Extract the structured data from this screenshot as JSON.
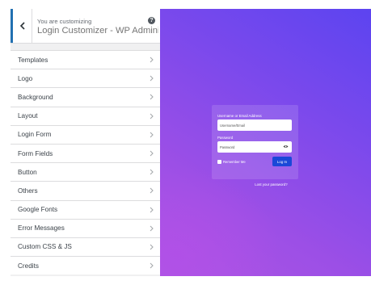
{
  "header": {
    "customizing_label": "You are customizing",
    "title": "Login Customizer - WP Adminify",
    "help_glyph": "?"
  },
  "sidebar": {
    "items": [
      {
        "label": "Templates",
        "name": "templates"
      },
      {
        "label": "Logo",
        "name": "logo"
      },
      {
        "label": "Background",
        "name": "background"
      },
      {
        "label": "Layout",
        "name": "layout"
      },
      {
        "label": "Login Form",
        "name": "login-form"
      },
      {
        "label": "Form Fields",
        "name": "form-fields"
      },
      {
        "label": "Button",
        "name": "button"
      },
      {
        "label": "Others",
        "name": "others"
      },
      {
        "label": "Google Fonts",
        "name": "google-fonts"
      },
      {
        "label": "Error Messages",
        "name": "error-messages"
      },
      {
        "label": "Custom CSS & JS",
        "name": "custom-css-js"
      },
      {
        "label": "Credits",
        "name": "credits"
      }
    ]
  },
  "preview": {
    "username_label": "Username or Email Address",
    "username_value": "Username/Email",
    "password_label": "Password",
    "password_value": "Password",
    "remember_label": "Remember Me",
    "login_button": "Log In",
    "lost_password": "Lost your password?"
  },
  "colors": {
    "accent": "#2271b1",
    "button": "#1a48d8",
    "bg_start": "#5c44f0",
    "bg_end": "#ad55e2"
  },
  "icons": {
    "back": "chevron-left-icon",
    "help": "help-icon",
    "item": "chevron-right-icon",
    "password_toggle": "eye-icon"
  }
}
